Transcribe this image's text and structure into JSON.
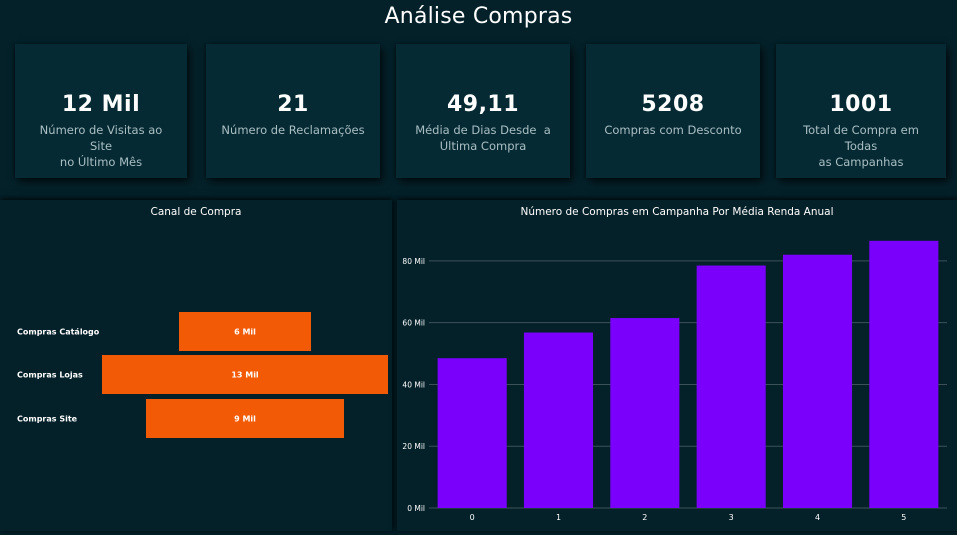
{
  "dashboard": {
    "title": "Análise Compras"
  },
  "kpis": [
    {
      "value": "12 Mil",
      "label_line1": "Número de Visitas ao Site",
      "label_line2": "no Último Mês"
    },
    {
      "value": "21",
      "label_line1": "Número de Reclamações",
      "label_line2": ""
    },
    {
      "value": "49,11",
      "label_line1": "Média de Dias Desde  a",
      "label_line2": "Última Compra"
    },
    {
      "value": "5208",
      "label_line1": "Compras com Desconto",
      "label_line2": ""
    },
    {
      "value": "1001",
      "label_line1": "Total de Compra em Todas",
      "label_line2": "as Campanhas"
    }
  ],
  "colors": {
    "background": "#04212a",
    "card": "#062a33",
    "funnel_bar": "#f25a06",
    "column_bar": "#7a00fb",
    "gridline": "#3b5259"
  },
  "chart_data": [
    {
      "type": "bar",
      "orientation": "horizontal-funnel",
      "title": "Canal de Compra",
      "categories": [
        "Compras Catálogo",
        "Compras Lojas",
        "Compras Site"
      ],
      "values": [
        6000,
        13000,
        9000
      ],
      "data_labels": [
        "6 Mil",
        "13 Mil",
        "9 Mil"
      ]
    },
    {
      "type": "bar",
      "title": "Número de Compras em Campanha Por Média Renda Anual",
      "categories": [
        "0",
        "1",
        "2",
        "3",
        "4",
        "5"
      ],
      "values": [
        48500,
        56800,
        61500,
        78500,
        82000,
        86500
      ],
      "ylim": [
        0,
        90000
      ],
      "yticks": [
        0,
        20000,
        40000,
        60000,
        80000
      ],
      "ytick_labels": [
        "0 Mil",
        "20 Mil",
        "40 Mil",
        "60 Mil",
        "80 Mil"
      ],
      "grid": true
    }
  ]
}
